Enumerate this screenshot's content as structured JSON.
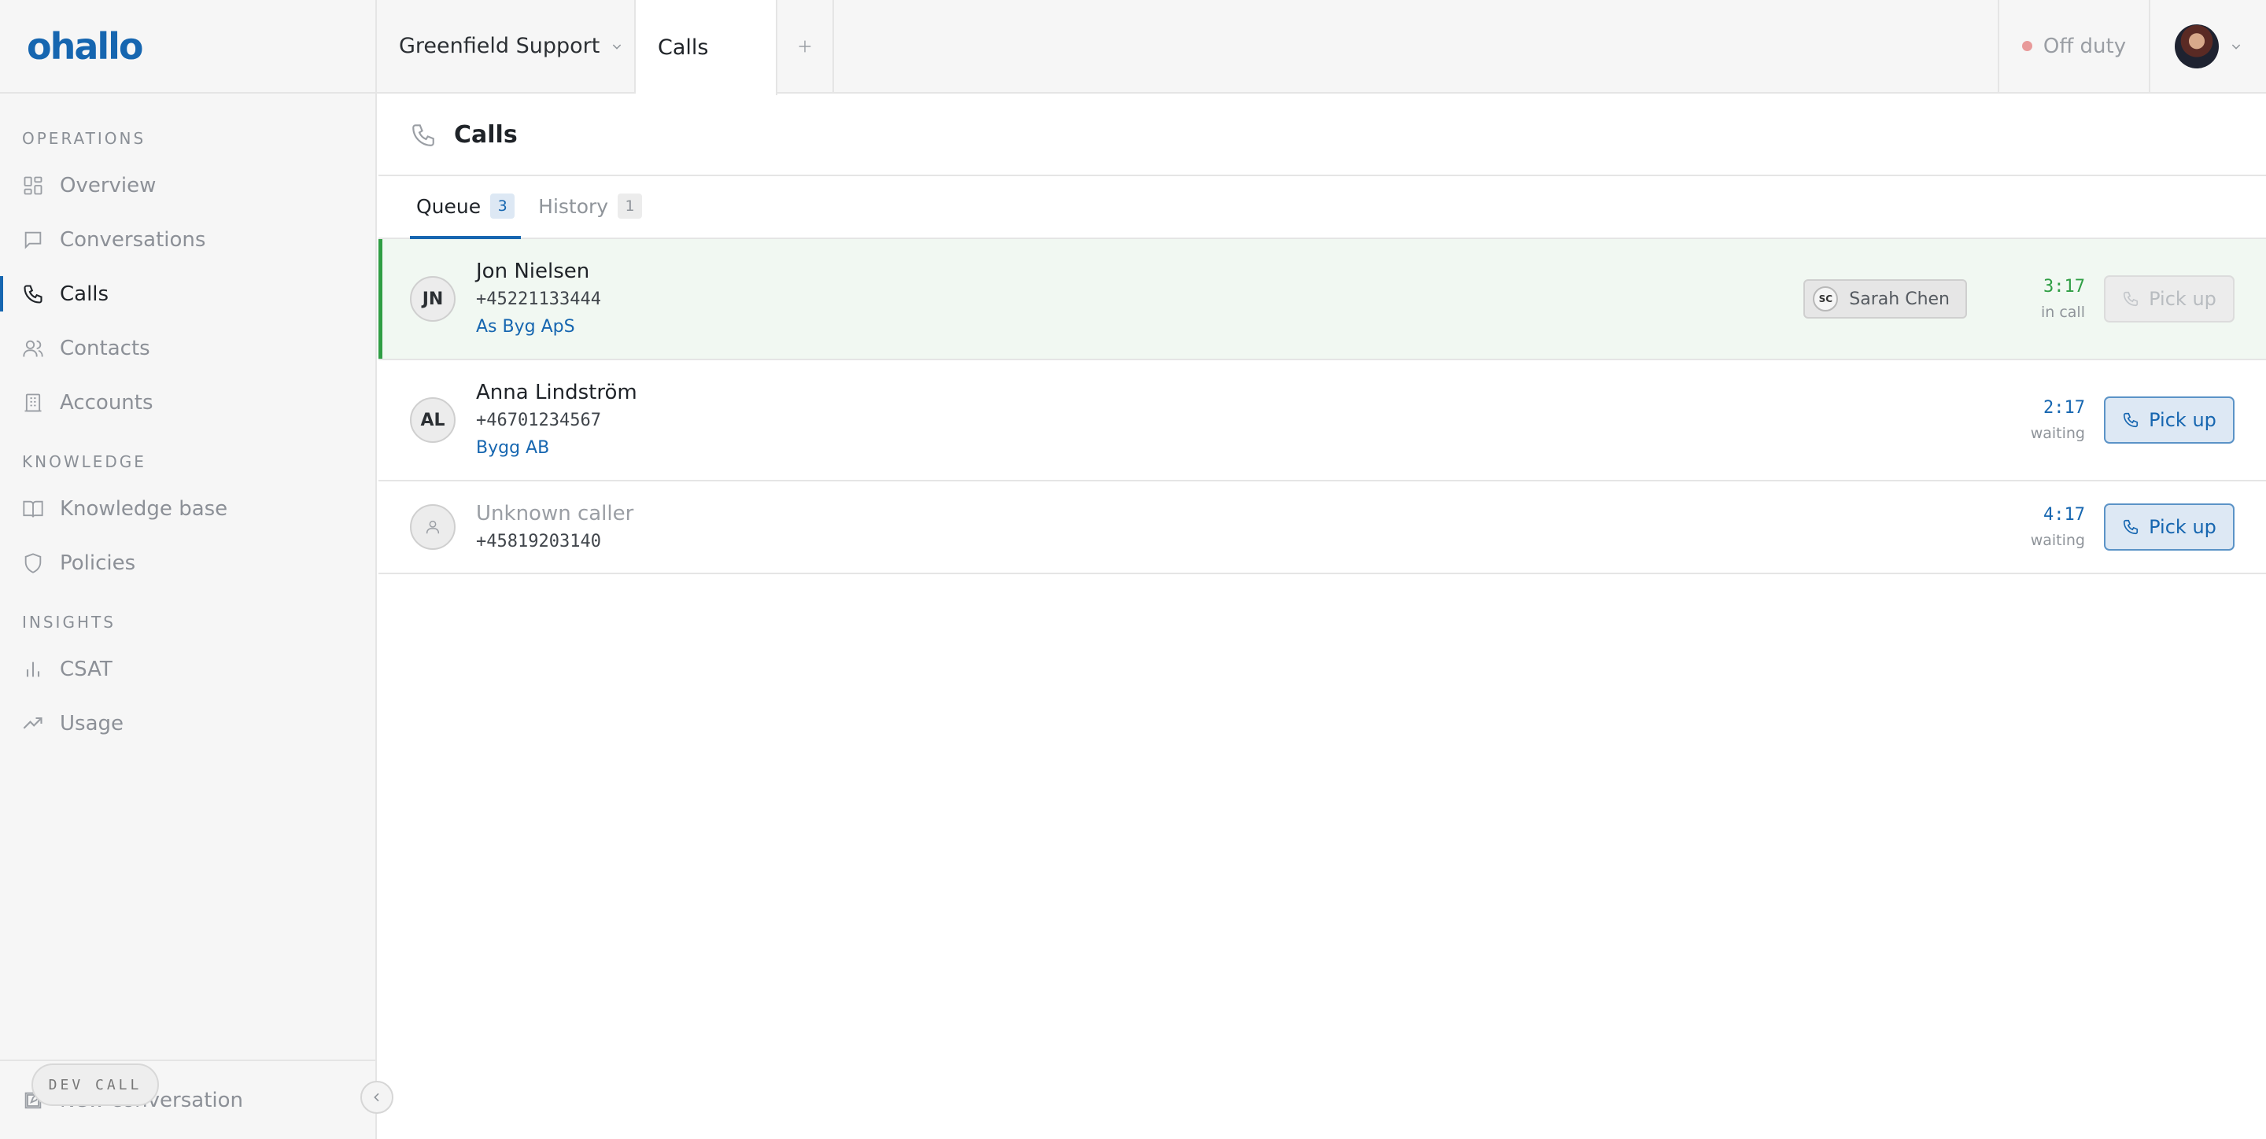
{
  "app": {
    "logo_text": "ohallo"
  },
  "sidebar": {
    "sections": [
      {
        "heading": "OPERATIONS",
        "items": [
          {
            "label": "Overview",
            "icon": "grid-icon"
          },
          {
            "label": "Conversations",
            "icon": "chat-icon"
          },
          {
            "label": "Calls",
            "icon": "phone-icon",
            "active": true
          },
          {
            "label": "Contacts",
            "icon": "users-icon"
          },
          {
            "label": "Accounts",
            "icon": "building-icon"
          }
        ]
      },
      {
        "heading": "KNOWLEDGE",
        "items": [
          {
            "label": "Knowledge base",
            "icon": "book-icon"
          },
          {
            "label": "Policies",
            "icon": "shield-icon"
          }
        ]
      },
      {
        "heading": "INSIGHTS",
        "items": [
          {
            "label": "CSAT",
            "icon": "bar-chart-icon"
          },
          {
            "label": "Usage",
            "icon": "trending-icon"
          }
        ]
      }
    ],
    "footer_label": "New conversation",
    "dev_badge": "DEV CALL"
  },
  "topbar": {
    "workspace": "Greenfield Support",
    "open_tab": "Calls",
    "status": "Off duty"
  },
  "page": {
    "title": "Calls",
    "tabs": [
      {
        "label": "Queue",
        "count": "3",
        "active": true
      },
      {
        "label": "History",
        "count": "1",
        "active": false
      }
    ]
  },
  "calls": [
    {
      "initials": "JN",
      "name": "Jon Nielsen",
      "phone": "+45221133444",
      "company": "As Byg ApS",
      "agent": {
        "initials": "SC",
        "name": "Sarah Chen"
      },
      "timer": "3:17",
      "state": "in call",
      "pickup_label": "Pick up",
      "pickup_enabled": false
    },
    {
      "initials": "AL",
      "name": "Anna Lindström",
      "phone": "+46701234567",
      "company": "Bygg AB",
      "timer": "2:17",
      "state": "waiting",
      "pickup_label": "Pick up",
      "pickup_enabled": true
    },
    {
      "initials": "",
      "name": "Unknown caller",
      "phone": "+45819203140",
      "company": "",
      "timer": "4:17",
      "state": "waiting",
      "pickup_label": "Pick up",
      "pickup_enabled": true
    }
  ],
  "colors": {
    "brand": "#1666b0",
    "active_call": "#2f9e44",
    "off_duty_dot": "#e89a9a"
  }
}
